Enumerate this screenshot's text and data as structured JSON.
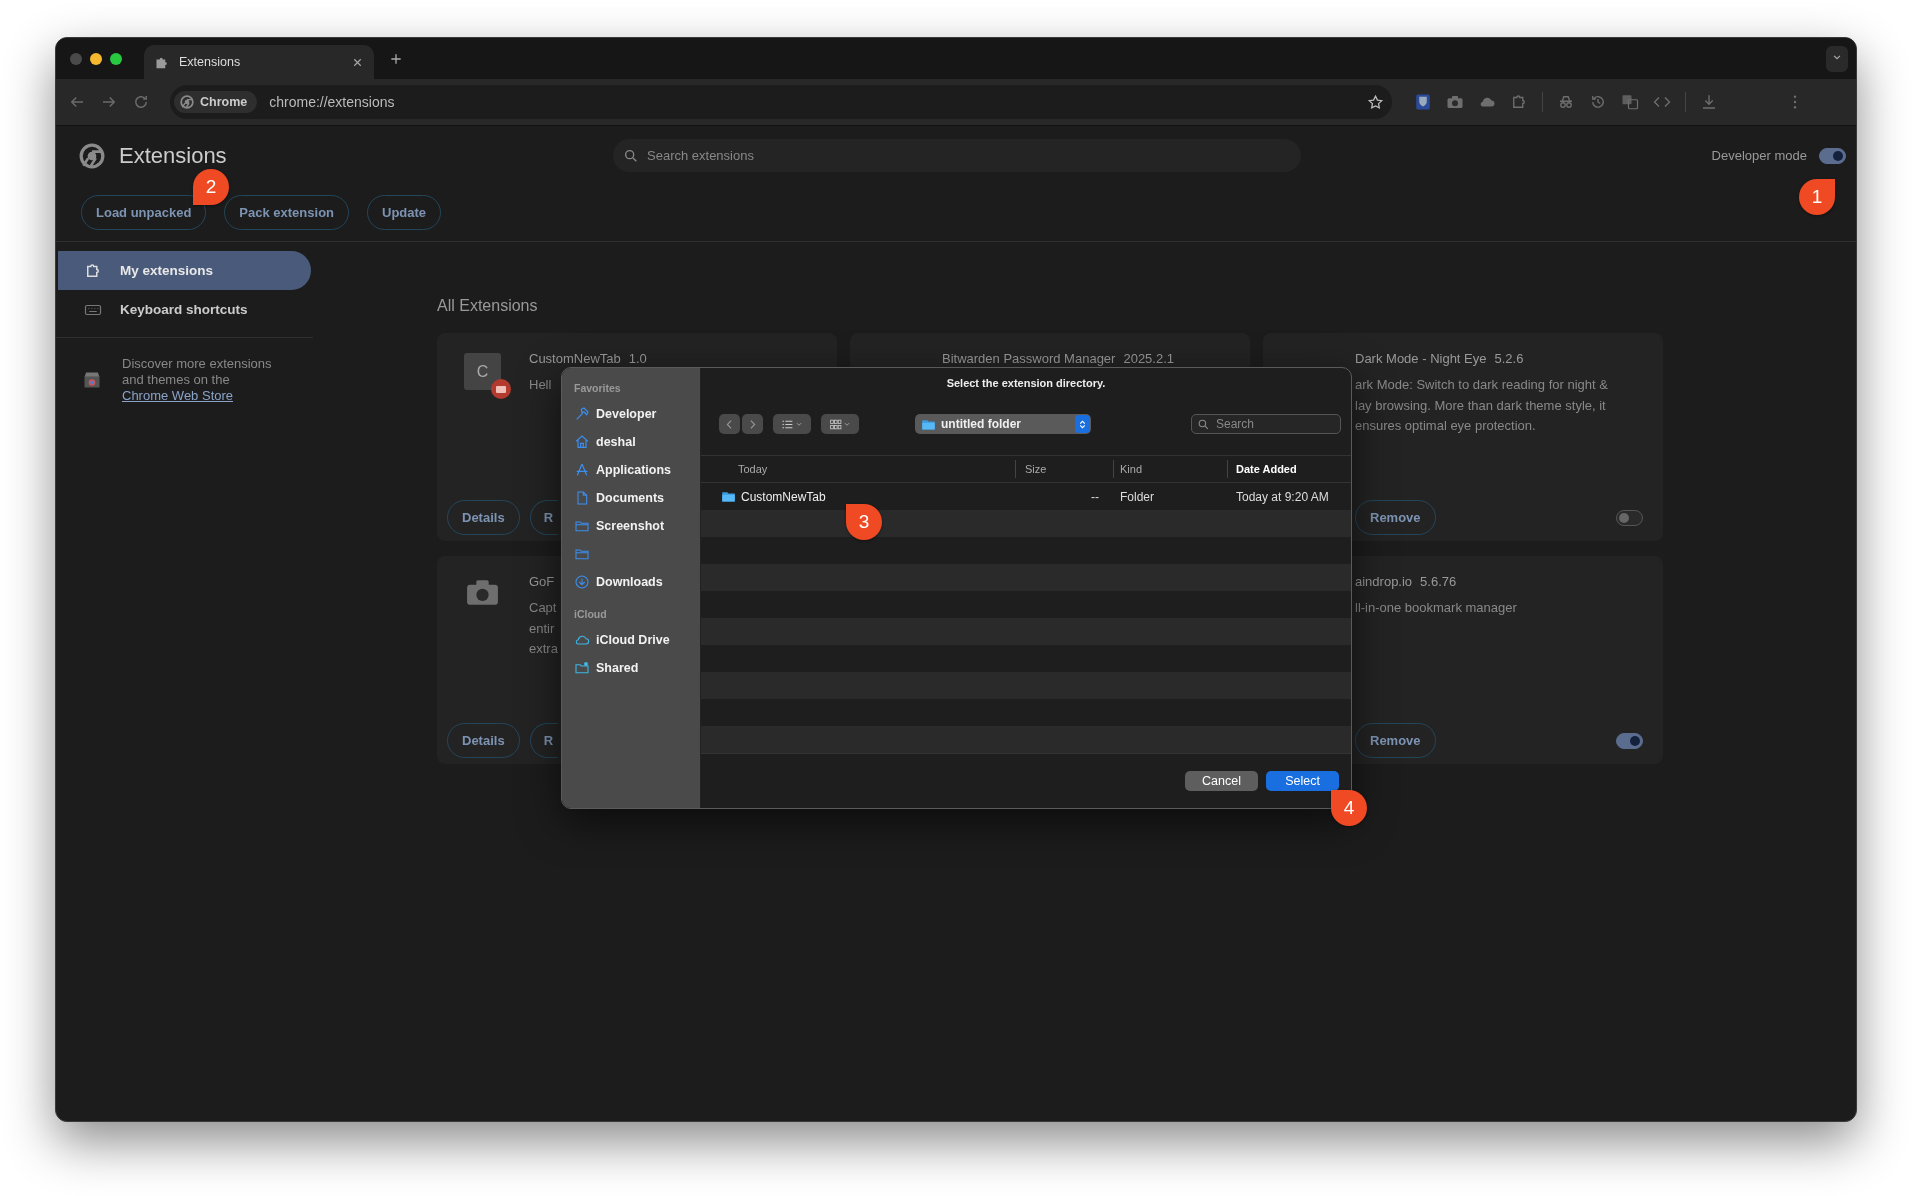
{
  "browser": {
    "tab": {
      "title": "Extensions"
    },
    "address": {
      "chip": "Chrome",
      "url": "chrome://extensions"
    }
  },
  "header": {
    "title": "Extensions",
    "search": {
      "placeholder": "Search extensions"
    },
    "developer_mode": {
      "label": "Developer mode",
      "on": true
    },
    "actions": [
      "Load unpacked",
      "Pack extension",
      "Update"
    ]
  },
  "sidebar": {
    "items": [
      {
        "label": "My extensions",
        "selected": true
      },
      {
        "label": "Keyboard shortcuts",
        "selected": false
      }
    ],
    "promo": {
      "lines": [
        "Discover more extensions",
        "and themes on the"
      ],
      "link": "Chrome Web Store"
    }
  },
  "main": {
    "heading": "All Extensions",
    "columns": [
      [
        {
          "kind": "letter",
          "letter": "C",
          "error": true,
          "name": "CustomNewTab",
          "version": "1.0",
          "description": [
            "Hell"
          ],
          "buttons": [
            "Details",
            "R"
          ]
        },
        {
          "kind": "camera",
          "name": "GoF",
          "description": [
            "Capt",
            "entir",
            "extra"
          ],
          "buttons": [
            "Details",
            "R"
          ]
        }
      ],
      [
        {
          "name": "Bitwarden Password Manager",
          "version": "2025.2.1"
        }
      ],
      [
        {
          "name": "Dark Mode - Night Eye",
          "version": "5.2.6",
          "description": [
            "ark Mode: Switch to dark reading for night &",
            "lay browsing. More than dark theme style, it",
            "ensures optimal eye protection."
          ],
          "buttons": [
            "Remove"
          ],
          "enabled": false
        },
        {
          "name": "aindrop.io",
          "version": "5.6.76",
          "description": [
            "ll-in-one bookmark manager"
          ],
          "buttons": [
            "Remove"
          ],
          "enabled": true
        }
      ]
    ]
  },
  "dialog": {
    "sections": [
      {
        "heading": "Favorites",
        "items": [
          {
            "kind": "tool",
            "label": "Developer"
          },
          {
            "kind": "home",
            "label": "deshal"
          },
          {
            "kind": "apps",
            "label": "Applications"
          },
          {
            "kind": "document",
            "label": "Documents"
          },
          {
            "kind": "folder",
            "label": "Screenshot"
          },
          {
            "kind": "folder"
          },
          {
            "kind": "download",
            "label": "Downloads"
          }
        ]
      },
      {
        "heading": "iCloud",
        "items": [
          {
            "kind": "cloud",
            "label": "iCloud Drive"
          },
          {
            "kind": "shared",
            "label": "Shared"
          }
        ]
      }
    ],
    "message": "Select the extension directory.",
    "location": "untitled folder",
    "search": {
      "placeholder": "Search"
    },
    "columns": [
      {
        "label": "Today",
        "sorted": false
      },
      {
        "label": "Size",
        "sorted": false
      },
      {
        "label": "Kind",
        "sorted": false
      },
      {
        "label": "Date Added",
        "sorted": true
      }
    ],
    "rows": [
      {
        "name": "CustomNewTab",
        "size": "--",
        "kind": "Folder",
        "date_added": "Today at 9:20 AM"
      }
    ],
    "buttons": [
      {
        "label": "Cancel",
        "kind": "secondary"
      },
      {
        "label": "Select",
        "kind": "primary"
      }
    ]
  },
  "callouts": [
    {
      "number": "1"
    },
    {
      "number": "2"
    },
    {
      "number": "3"
    },
    {
      "number": "4"
    }
  ]
}
